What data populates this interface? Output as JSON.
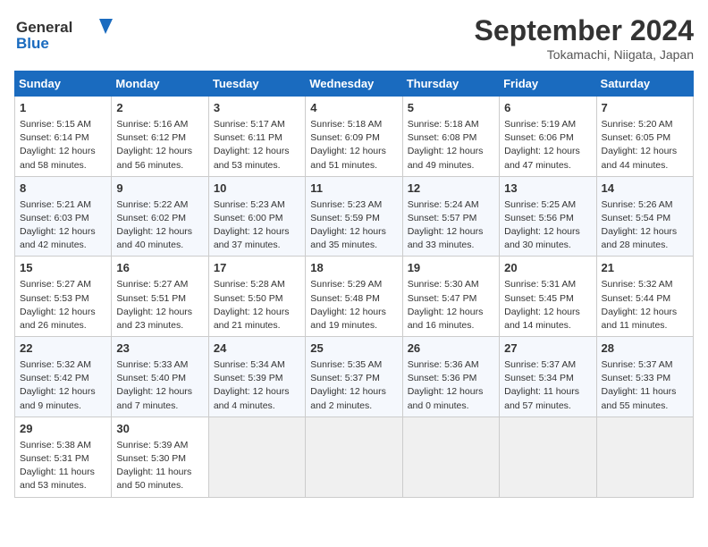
{
  "header": {
    "logo_line1": "General",
    "logo_line2": "Blue",
    "month": "September 2024",
    "location": "Tokamachi, Niigata, Japan"
  },
  "days_of_week": [
    "Sunday",
    "Monday",
    "Tuesday",
    "Wednesday",
    "Thursday",
    "Friday",
    "Saturday"
  ],
  "weeks": [
    [
      {
        "day": "1",
        "rise": "5:15 AM",
        "set": "6:14 PM",
        "hours": "12 hours",
        "mins": "58 minutes"
      },
      {
        "day": "2",
        "rise": "5:16 AM",
        "set": "6:12 PM",
        "hours": "12 hours",
        "mins": "56 minutes"
      },
      {
        "day": "3",
        "rise": "5:17 AM",
        "set": "6:11 PM",
        "hours": "12 hours",
        "mins": "53 minutes"
      },
      {
        "day": "4",
        "rise": "5:18 AM",
        "set": "6:09 PM",
        "hours": "12 hours",
        "mins": "51 minutes"
      },
      {
        "day": "5",
        "rise": "5:18 AM",
        "set": "6:08 PM",
        "hours": "12 hours",
        "mins": "49 minutes"
      },
      {
        "day": "6",
        "rise": "5:19 AM",
        "set": "6:06 PM",
        "hours": "12 hours",
        "mins": "47 minutes"
      },
      {
        "day": "7",
        "rise": "5:20 AM",
        "set": "6:05 PM",
        "hours": "12 hours",
        "mins": "44 minutes"
      }
    ],
    [
      {
        "day": "8",
        "rise": "5:21 AM",
        "set": "6:03 PM",
        "hours": "12 hours",
        "mins": "42 minutes"
      },
      {
        "day": "9",
        "rise": "5:22 AM",
        "set": "6:02 PM",
        "hours": "12 hours",
        "mins": "40 minutes"
      },
      {
        "day": "10",
        "rise": "5:23 AM",
        "set": "6:00 PM",
        "hours": "12 hours",
        "mins": "37 minutes"
      },
      {
        "day": "11",
        "rise": "5:23 AM",
        "set": "5:59 PM",
        "hours": "12 hours",
        "mins": "35 minutes"
      },
      {
        "day": "12",
        "rise": "5:24 AM",
        "set": "5:57 PM",
        "hours": "12 hours",
        "mins": "33 minutes"
      },
      {
        "day": "13",
        "rise": "5:25 AM",
        "set": "5:56 PM",
        "hours": "12 hours",
        "mins": "30 minutes"
      },
      {
        "day": "14",
        "rise": "5:26 AM",
        "set": "5:54 PM",
        "hours": "12 hours",
        "mins": "28 minutes"
      }
    ],
    [
      {
        "day": "15",
        "rise": "5:27 AM",
        "set": "5:53 PM",
        "hours": "12 hours",
        "mins": "26 minutes"
      },
      {
        "day": "16",
        "rise": "5:27 AM",
        "set": "5:51 PM",
        "hours": "12 hours",
        "mins": "23 minutes"
      },
      {
        "day": "17",
        "rise": "5:28 AM",
        "set": "5:50 PM",
        "hours": "12 hours",
        "mins": "21 minutes"
      },
      {
        "day": "18",
        "rise": "5:29 AM",
        "set": "5:48 PM",
        "hours": "12 hours",
        "mins": "19 minutes"
      },
      {
        "day": "19",
        "rise": "5:30 AM",
        "set": "5:47 PM",
        "hours": "12 hours",
        "mins": "16 minutes"
      },
      {
        "day": "20",
        "rise": "5:31 AM",
        "set": "5:45 PM",
        "hours": "12 hours",
        "mins": "14 minutes"
      },
      {
        "day": "21",
        "rise": "5:32 AM",
        "set": "5:44 PM",
        "hours": "12 hours",
        "mins": "11 minutes"
      }
    ],
    [
      {
        "day": "22",
        "rise": "5:32 AM",
        "set": "5:42 PM",
        "hours": "12 hours",
        "mins": "9 minutes"
      },
      {
        "day": "23",
        "rise": "5:33 AM",
        "set": "5:40 PM",
        "hours": "12 hours",
        "mins": "7 minutes"
      },
      {
        "day": "24",
        "rise": "5:34 AM",
        "set": "5:39 PM",
        "hours": "12 hours",
        "mins": "4 minutes"
      },
      {
        "day": "25",
        "rise": "5:35 AM",
        "set": "5:37 PM",
        "hours": "12 hours",
        "mins": "2 minutes"
      },
      {
        "day": "26",
        "rise": "5:36 AM",
        "set": "5:36 PM",
        "hours": "12 hours",
        "mins": "0 minutes"
      },
      {
        "day": "27",
        "rise": "5:37 AM",
        "set": "5:34 PM",
        "hours": "11 hours",
        "mins": "57 minutes"
      },
      {
        "day": "28",
        "rise": "5:37 AM",
        "set": "5:33 PM",
        "hours": "11 hours",
        "mins": "55 minutes"
      }
    ],
    [
      {
        "day": "29",
        "rise": "5:38 AM",
        "set": "5:31 PM",
        "hours": "11 hours",
        "mins": "53 minutes"
      },
      {
        "day": "30",
        "rise": "5:39 AM",
        "set": "5:30 PM",
        "hours": "11 hours",
        "mins": "50 minutes"
      },
      null,
      null,
      null,
      null,
      null
    ]
  ],
  "labels": {
    "sunrise": "Sunrise:",
    "sunset": "Sunset:",
    "daylight": "Daylight:"
  }
}
